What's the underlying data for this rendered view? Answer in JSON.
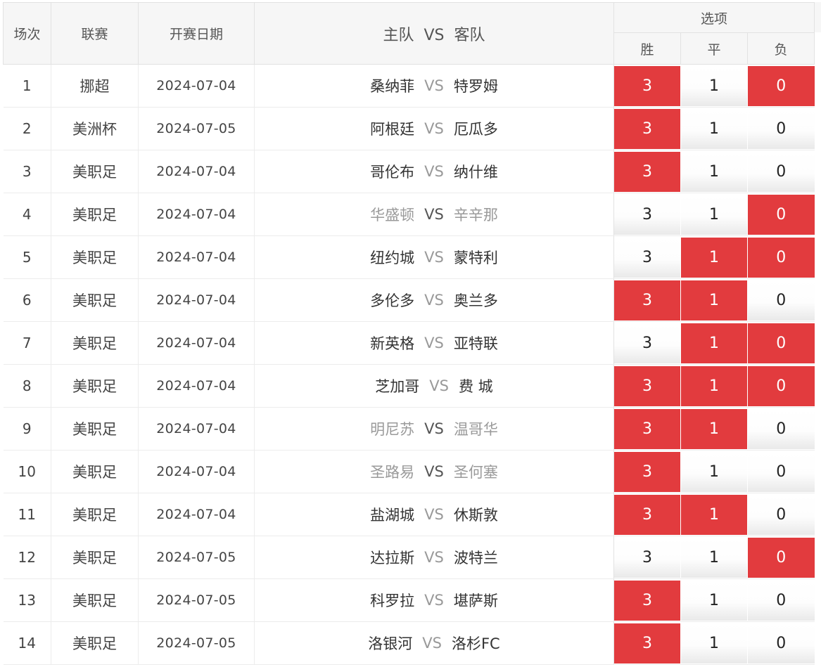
{
  "header": {
    "no": "场次",
    "league": "联赛",
    "date": "开赛日期",
    "match": "主队  VS  客队",
    "options_title": "选项",
    "win": "胜",
    "draw": "平",
    "loss": "负"
  },
  "colors": {
    "selected": "#e23b3e",
    "header_bg": "#f6f6f6"
  },
  "rows": [
    {
      "no": "1",
      "league": "挪超",
      "date": "2024-07-04",
      "home": "桑纳菲",
      "vs": "VS",
      "away": "特罗姆",
      "dim": false,
      "win": "3",
      "draw": "1",
      "loss": "0",
      "win_sel": true,
      "draw_sel": false,
      "loss_sel": true
    },
    {
      "no": "2",
      "league": "美洲杯",
      "date": "2024-07-05",
      "home": "阿根廷",
      "vs": "VS",
      "away": "厄瓜多",
      "dim": false,
      "win": "3",
      "draw": "1",
      "loss": "0",
      "win_sel": true,
      "draw_sel": false,
      "loss_sel": false
    },
    {
      "no": "3",
      "league": "美职足",
      "date": "2024-07-04",
      "home": "哥伦布",
      "vs": "VS",
      "away": "纳什维",
      "dim": false,
      "win": "3",
      "draw": "1",
      "loss": "0",
      "win_sel": true,
      "draw_sel": false,
      "loss_sel": false
    },
    {
      "no": "4",
      "league": "美职足",
      "date": "2024-07-04",
      "home": "华盛顿",
      "vs": "VS",
      "away": "辛辛那",
      "dim": true,
      "win": "3",
      "draw": "1",
      "loss": "0",
      "win_sel": false,
      "draw_sel": false,
      "loss_sel": true
    },
    {
      "no": "5",
      "league": "美职足",
      "date": "2024-07-04",
      "home": "纽约城",
      "vs": "VS",
      "away": "蒙特利",
      "dim": false,
      "win": "3",
      "draw": "1",
      "loss": "0",
      "win_sel": false,
      "draw_sel": true,
      "loss_sel": true
    },
    {
      "no": "6",
      "league": "美职足",
      "date": "2024-07-04",
      "home": "多伦多",
      "vs": "VS",
      "away": "奥兰多",
      "dim": false,
      "win": "3",
      "draw": "1",
      "loss": "0",
      "win_sel": true,
      "draw_sel": true,
      "loss_sel": false
    },
    {
      "no": "7",
      "league": "美职足",
      "date": "2024-07-04",
      "home": "新英格",
      "vs": "VS",
      "away": "亚特联",
      "dim": false,
      "win": "3",
      "draw": "1",
      "loss": "0",
      "win_sel": false,
      "draw_sel": true,
      "loss_sel": true
    },
    {
      "no": "8",
      "league": "美职足",
      "date": "2024-07-04",
      "home": "芝加哥",
      "vs": "VS",
      "away": "费 城",
      "dim": false,
      "win": "3",
      "draw": "1",
      "loss": "0",
      "win_sel": true,
      "draw_sel": true,
      "loss_sel": true
    },
    {
      "no": "9",
      "league": "美职足",
      "date": "2024-07-04",
      "home": "明尼苏",
      "vs": "VS",
      "away": "温哥华",
      "dim": true,
      "win": "3",
      "draw": "1",
      "loss": "0",
      "win_sel": true,
      "draw_sel": true,
      "loss_sel": false
    },
    {
      "no": "10",
      "league": "美职足",
      "date": "2024-07-04",
      "home": "圣路易",
      "vs": "VS",
      "away": "圣何塞",
      "dim": true,
      "win": "3",
      "draw": "1",
      "loss": "0",
      "win_sel": true,
      "draw_sel": false,
      "loss_sel": false
    },
    {
      "no": "11",
      "league": "美职足",
      "date": "2024-07-04",
      "home": "盐湖城",
      "vs": "VS",
      "away": "休斯敦",
      "dim": false,
      "win": "3",
      "draw": "1",
      "loss": "0",
      "win_sel": true,
      "draw_sel": true,
      "loss_sel": false
    },
    {
      "no": "12",
      "league": "美职足",
      "date": "2024-07-05",
      "home": "达拉斯",
      "vs": "VS",
      "away": "波特兰",
      "dim": false,
      "win": "3",
      "draw": "1",
      "loss": "0",
      "win_sel": false,
      "draw_sel": false,
      "loss_sel": true
    },
    {
      "no": "13",
      "league": "美职足",
      "date": "2024-07-05",
      "home": "科罗拉",
      "vs": "VS",
      "away": "堪萨斯",
      "dim": false,
      "win": "3",
      "draw": "1",
      "loss": "0",
      "win_sel": true,
      "draw_sel": false,
      "loss_sel": false
    },
    {
      "no": "14",
      "league": "美职足",
      "date": "2024-07-05",
      "home": "洛银河",
      "vs": "VS",
      "away": "洛杉FC",
      "dim": false,
      "win": "3",
      "draw": "1",
      "loss": "0",
      "win_sel": true,
      "draw_sel": false,
      "loss_sel": false
    }
  ]
}
